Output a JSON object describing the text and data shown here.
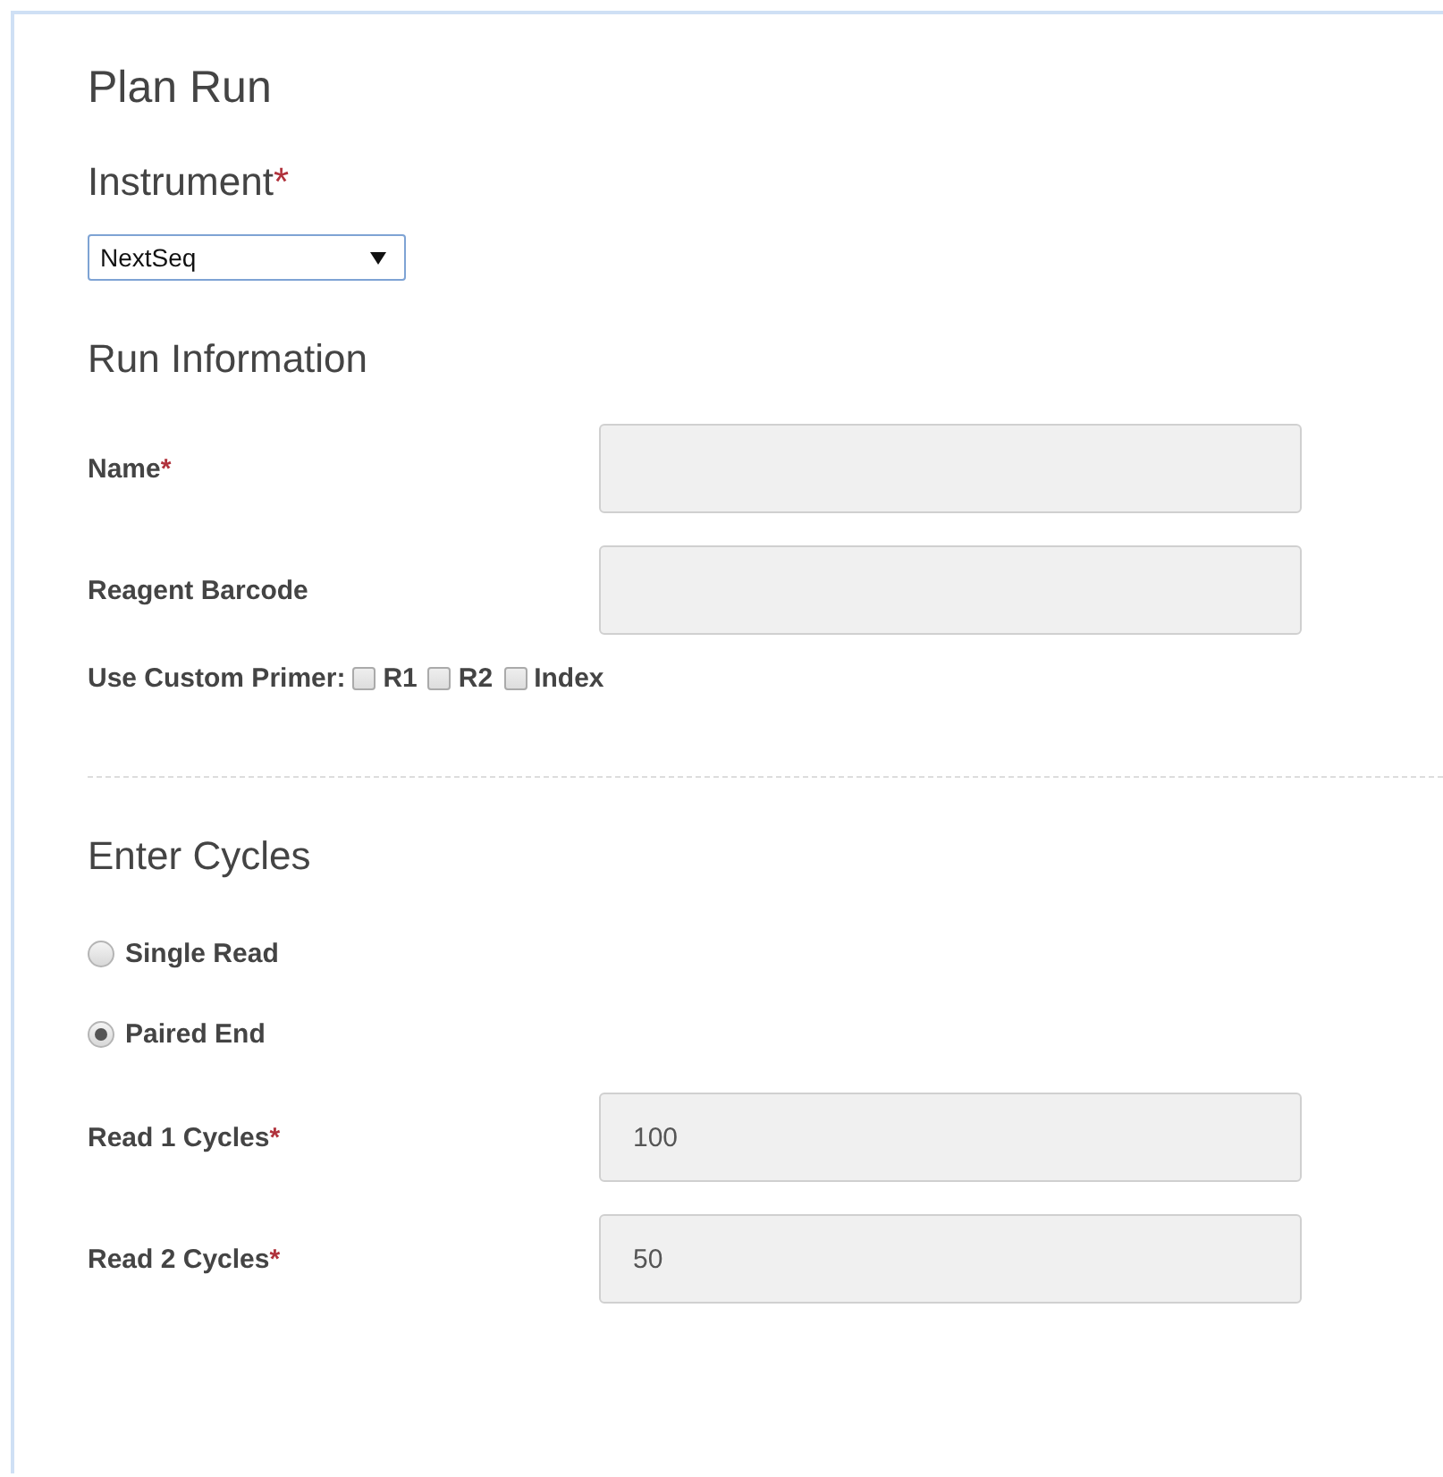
{
  "title": "Plan Run",
  "instrument": {
    "label": "Instrument",
    "required_mark": "*",
    "value": "NextSeq"
  },
  "run_information": {
    "heading": "Run Information",
    "fields": [
      {
        "label": "Name",
        "required_mark": "*"
      },
      {
        "label": "Reagent Barcode"
      }
    ],
    "custom_primer": {
      "label": "Use Custom Primer:",
      "options": [
        {
          "label": "R1",
          "checked": false
        },
        {
          "label": "R2",
          "checked": false
        },
        {
          "label": "Index",
          "checked": false
        }
      ]
    }
  },
  "enter_cycles": {
    "heading": "Enter Cycles",
    "read_types": [
      {
        "label": "Single Read",
        "selected": false
      },
      {
        "label": "Paired End",
        "selected": true
      }
    ],
    "fields": [
      {
        "label": "Read 1 Cycles",
        "required_mark": "*",
        "value": "100"
      },
      {
        "label": "Read 2 Cycles",
        "required_mark": "*",
        "value": "50"
      }
    ]
  }
}
